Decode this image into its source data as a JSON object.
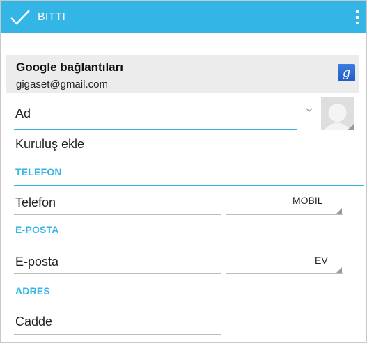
{
  "action_bar": {
    "done_label": "BITTI",
    "done_icon": "check-icon",
    "overflow_icon": "overflow-menu-icon",
    "color": "#33b5e5"
  },
  "account": {
    "title": "Google bağlantıları",
    "email": "gigaset@gmail.com",
    "badge_icon": "google-icon",
    "badge_letter": "g"
  },
  "name": {
    "value": "Ad",
    "expand_icon": "chevron-down-icon",
    "photo_icon": "contact-photo-icon"
  },
  "organization": {
    "label": "Kuruluş ekle"
  },
  "phone": {
    "section": "TELEFON",
    "placeholder": "Telefon",
    "type": "MOBIL"
  },
  "email": {
    "section": "E-POSTA",
    "placeholder": "E-posta",
    "type": "EV"
  },
  "address": {
    "section": "ADRES",
    "placeholder": "Cadde"
  },
  "accent_color": "#33b5e5"
}
